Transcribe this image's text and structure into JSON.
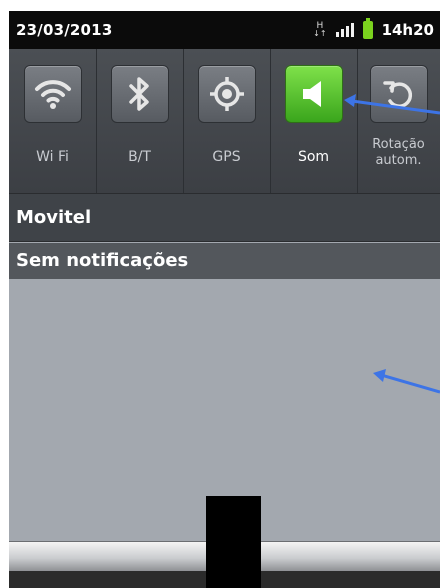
{
  "status_bar": {
    "date": "23/03/2013",
    "network_type": "H",
    "time": "14h20",
    "icons": [
      "data-activity-icon",
      "signal-strength-icon",
      "battery-icon"
    ]
  },
  "quick_settings": [
    {
      "label": "Wi Fi",
      "icon": "wifi-icon",
      "active": false
    },
    {
      "label": "B/T",
      "icon": "bluetooth-icon",
      "active": false
    },
    {
      "label": "GPS",
      "icon": "gps-icon",
      "active": false
    },
    {
      "label": "Som",
      "icon": "speaker-icon",
      "active": true
    },
    {
      "label": "Rotação\nautom.",
      "label_line1": "Rotação",
      "label_line2": "autom.",
      "icon": "rotate-icon",
      "active": false
    }
  ],
  "operator": "Movitel",
  "notifications": {
    "header": "Sem notificações"
  },
  "colors": {
    "active_tile": "#4cc12a",
    "annotation_arrow": "#3d74e6"
  }
}
